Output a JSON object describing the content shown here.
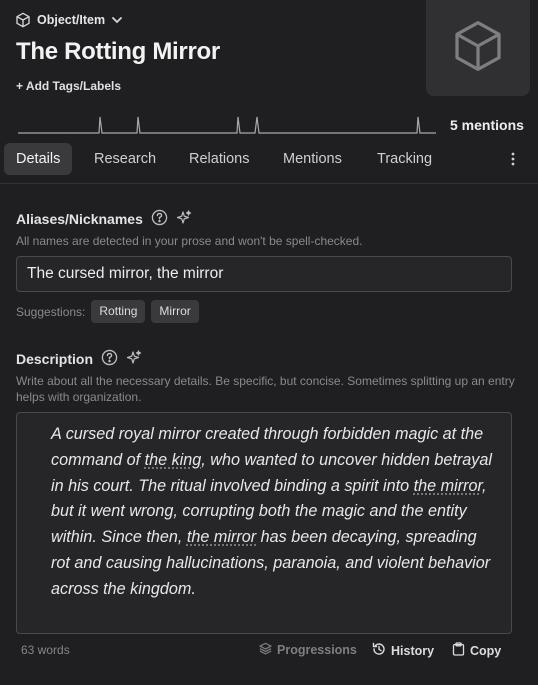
{
  "entity_type": {
    "label": "Object/Item",
    "icon": "cube-icon"
  },
  "title": "The Rotting Mirror",
  "add_tags_label": "+ Add Tags/Labels",
  "mentions_count": "5 mentions",
  "tabs": [
    {
      "label": "Details",
      "active": true
    },
    {
      "label": "Research",
      "active": false
    },
    {
      "label": "Relations",
      "active": false
    },
    {
      "label": "Mentions",
      "active": false
    },
    {
      "label": "Tracking",
      "active": false
    }
  ],
  "aliases": {
    "label": "Aliases/Nicknames",
    "hint": "All names are detected in your prose and won't be spell-checked.",
    "value": "The cursed mirror, the mirror",
    "suggestions_label": "Suggestions:",
    "suggestions": [
      "Rotting",
      "Mirror"
    ]
  },
  "description": {
    "label": "Description",
    "hint": "Write about all the necessary details. Be specific, but concise. Sometimes splitting up an entry helps with organization.",
    "text_segments": [
      {
        "text": "A cursed royal mirror created through forbidden magic at the command of ",
        "mention": false
      },
      {
        "text": "the king",
        "mention": true
      },
      {
        "text": ", who wanted to uncover hidden betrayal in his court. The ritual involved binding a spirit into ",
        "mention": false
      },
      {
        "text": "the mirror",
        "mention": true
      },
      {
        "text": ", but it went wrong, corrupting both the magic and the entity within. Since then, ",
        "mention": false
      },
      {
        "text": "the mirror",
        "mention": true
      },
      {
        "text": " has been decaying, spreading rot and causing hallucinations, paranoia, and violent behavior across the kingdom.",
        "mention": false
      }
    ]
  },
  "footer": {
    "word_count": "63 words",
    "progressions_label": "Progressions",
    "history_label": "History",
    "copy_label": "Copy"
  },
  "colors": {
    "background": "#1f1f21",
    "field": "#262629",
    "chip": "#3a3a3d",
    "muted": "#8a8a8e"
  }
}
